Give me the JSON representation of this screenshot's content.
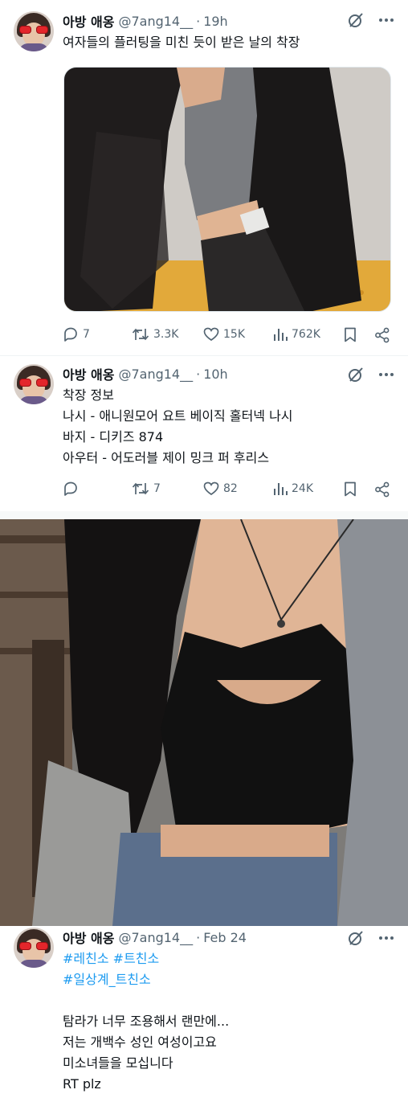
{
  "tweets": [
    {
      "display_name": "아방 애옹",
      "handle": "@7ang14__",
      "separator": "·",
      "time": "19h",
      "lines": [
        "여자들의 플러팅을 미친 듯이 받은 날의 착장"
      ],
      "has_media": true,
      "stats": {
        "replies": "7",
        "retweets": "3.3K",
        "likes": "15K",
        "views": "762K"
      }
    },
    {
      "display_name": "아방 애옹",
      "handle": "@7ang14__",
      "separator": "·",
      "time": "10h",
      "lines": [
        "착장 정보",
        "나시 - 애니원모어 요트 베이직 홀터넥 나시",
        "바지 - 디키즈 874",
        "아우터 - 어도러블 제이 밍크 퍼 후리스"
      ],
      "stats": {
        "replies": "",
        "retweets": "7",
        "likes": "82",
        "views": "24K"
      }
    },
    {
      "display_name": "아방 애옹",
      "handle": "@7ang14__",
      "separator": "·",
      "time": "Feb 24",
      "hashtags": [
        "#레친소",
        "#트친소",
        "#일상계_트친소"
      ],
      "lines": [
        "탐라가 너무 조용해서 랜만에...",
        "저는 개백수 성인 여성이고요",
        "미소녀들을 모십니다",
        "RT plz"
      ]
    }
  ],
  "colors": {
    "text": "#0f1419",
    "secondary": "#536471",
    "hashtag": "#1d9bf0",
    "divider": "#eff3f4"
  },
  "icons": [
    "grok-icon",
    "more-icon",
    "reply-icon",
    "retweet-icon",
    "like-icon",
    "views-icon",
    "bookmark-icon",
    "share-icon"
  ]
}
